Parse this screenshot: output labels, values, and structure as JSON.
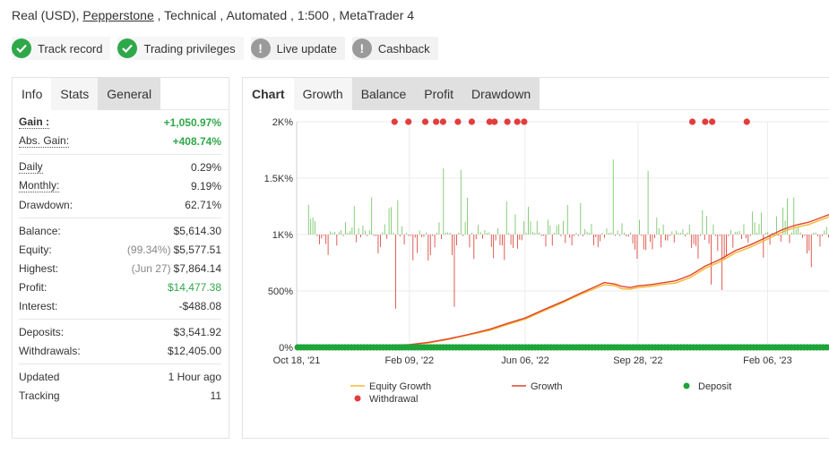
{
  "header": {
    "prefix": "Real (USD), ",
    "broker": "Pepperstone",
    "suffix": " , Technical , Automated , 1:500 , MetaTrader 4"
  },
  "badges": [
    {
      "label": "Track record",
      "status": "verified",
      "icon": "check-circle-icon"
    },
    {
      "label": "Trading privileges",
      "status": "verified",
      "icon": "check-circle-icon"
    },
    {
      "label": "Live update",
      "status": "unverified",
      "icon": "exclamation-circle-icon"
    },
    {
      "label": "Cashback",
      "status": "unverified",
      "icon": "exclamation-circle-icon"
    }
  ],
  "left_tabs": [
    "Info",
    "Stats",
    "General"
  ],
  "stats": {
    "gain": {
      "label": "Gain :",
      "value": "+1,050.97%"
    },
    "abs_gain": {
      "label": "Abs. Gain:",
      "value": "+408.74%"
    },
    "daily": {
      "label": "Daily",
      "value": "0.29%"
    },
    "monthly": {
      "label": "Monthly:",
      "value": "9.19%"
    },
    "drawdown": {
      "label": "Drawdown:",
      "value": "62.71%"
    },
    "balance": {
      "label": "Balance:",
      "value": "$5,614.30"
    },
    "equity": {
      "label": "Equity:",
      "note": "(99.34%)",
      "value": "$5,577.51"
    },
    "highest": {
      "label": "Highest:",
      "note": "(Jun 27)",
      "value": "$7,864.14"
    },
    "profit": {
      "label": "Profit:",
      "value": "$14,477.38"
    },
    "interest": {
      "label": "Interest:",
      "value": "-$488.08"
    },
    "deposits": {
      "label": "Deposits:",
      "value": "$3,541.92"
    },
    "withdrawals": {
      "label": "Withdrawals:",
      "value": "$12,405.00"
    },
    "updated": {
      "label": "Updated",
      "value": "1 Hour ago"
    },
    "tracking": {
      "label": "Tracking",
      "value": "11"
    }
  },
  "right_tabs": [
    "Chart",
    "Growth",
    "Balance",
    "Profit",
    "Drawdown"
  ],
  "colors": {
    "verified": "#2fa84a",
    "unverified": "#9a9a9a",
    "equity": "#f5b731",
    "growth": "#e0452b",
    "deposit": "#1ea53a",
    "withdrawal": "#e23d3d",
    "bar_up": "#6cbf5c",
    "bar_down": "#d9342a"
  },
  "chart_data": {
    "type": "line",
    "ylim": [
      0,
      2000
    ],
    "y_ticks": [
      {
        "value": 0,
        "label": "0%"
      },
      {
        "value": 500,
        "label": "500%"
      },
      {
        "value": 1000,
        "label": "1K%"
      },
      {
        "value": 1500,
        "label": "1.5K%"
      },
      {
        "value": 2000,
        "label": "2K%"
      }
    ],
    "x_range": [
      "2021-10-18",
      "2023-04-10"
    ],
    "x_ticks": [
      {
        "date": "2021-10-18",
        "label": "Oct 18, '21"
      },
      {
        "date": "2022-02-09",
        "label": "Feb 09, '22"
      },
      {
        "date": "2022-06-06",
        "label": "Jun 06, '22"
      },
      {
        "date": "2022-09-28",
        "label": "Sep 28, '22"
      },
      {
        "date": "2023-02-06",
        "label": "Feb 06, '23"
      }
    ],
    "series": [
      {
        "name": "Equity Growth",
        "points": [
          [
            "2021-10-18",
            0
          ],
          [
            "2021-12-01",
            2
          ],
          [
            "2022-01-01",
            8
          ],
          [
            "2022-01-20",
            15
          ],
          [
            "2022-02-09",
            22
          ],
          [
            "2022-03-01",
            40
          ],
          [
            "2022-03-20",
            70
          ],
          [
            "2022-04-10",
            110
          ],
          [
            "2022-05-01",
            150
          ],
          [
            "2022-05-20",
            205
          ],
          [
            "2022-06-06",
            250
          ],
          [
            "2022-06-25",
            325
          ],
          [
            "2022-07-15",
            400
          ],
          [
            "2022-08-01",
            470
          ],
          [
            "2022-08-15",
            520
          ],
          [
            "2022-08-25",
            555
          ],
          [
            "2022-09-05",
            545
          ],
          [
            "2022-09-12",
            520
          ],
          [
            "2022-09-20",
            515
          ],
          [
            "2022-09-28",
            530
          ],
          [
            "2022-10-10",
            540
          ],
          [
            "2022-10-25",
            560
          ],
          [
            "2022-11-05",
            570
          ],
          [
            "2022-11-20",
            620
          ],
          [
            "2022-12-05",
            700
          ],
          [
            "2022-12-20",
            760
          ],
          [
            "2023-01-05",
            840
          ],
          [
            "2023-01-20",
            890
          ],
          [
            "2023-02-06",
            960
          ],
          [
            "2023-02-20",
            1020
          ],
          [
            "2023-03-05",
            1060
          ],
          [
            "2023-03-20",
            1090
          ],
          [
            "2023-04-01",
            1130
          ],
          [
            "2023-04-10",
            1160
          ]
        ]
      },
      {
        "name": "Growth",
        "points": [
          [
            "2021-10-18",
            0
          ],
          [
            "2021-12-01",
            3
          ],
          [
            "2022-01-01",
            10
          ],
          [
            "2022-01-20",
            18
          ],
          [
            "2022-02-09",
            25
          ],
          [
            "2022-03-01",
            45
          ],
          [
            "2022-03-20",
            75
          ],
          [
            "2022-04-10",
            115
          ],
          [
            "2022-05-01",
            160
          ],
          [
            "2022-05-20",
            215
          ],
          [
            "2022-06-06",
            260
          ],
          [
            "2022-06-25",
            335
          ],
          [
            "2022-07-15",
            410
          ],
          [
            "2022-08-01",
            480
          ],
          [
            "2022-08-15",
            535
          ],
          [
            "2022-08-25",
            575
          ],
          [
            "2022-09-05",
            560
          ],
          [
            "2022-09-12",
            540
          ],
          [
            "2022-09-20",
            530
          ],
          [
            "2022-09-28",
            545
          ],
          [
            "2022-10-10",
            555
          ],
          [
            "2022-10-25",
            575
          ],
          [
            "2022-11-05",
            590
          ],
          [
            "2022-11-20",
            640
          ],
          [
            "2022-12-05",
            720
          ],
          [
            "2022-12-20",
            780
          ],
          [
            "2023-01-05",
            860
          ],
          [
            "2023-01-20",
            910
          ],
          [
            "2023-02-06",
            980
          ],
          [
            "2023-02-20",
            1040
          ],
          [
            "2023-03-05",
            1080
          ],
          [
            "2023-03-20",
            1110
          ],
          [
            "2023-04-01",
            1150
          ],
          [
            "2023-04-10",
            1180
          ]
        ]
      }
    ],
    "deposits": {
      "name": "Deposit",
      "note": "near-daily deposit markers along the 0% baseline across the full date range"
    },
    "withdrawals": {
      "name": "Withdrawal",
      "marker_value": 2000,
      "dates": [
        "2022-01-25",
        "2022-02-08",
        "2022-02-25",
        "2022-03-08",
        "2022-03-15",
        "2022-03-30",
        "2022-04-13",
        "2022-05-01",
        "2022-05-06",
        "2022-05-19",
        "2022-05-29",
        "2022-06-05",
        "2022-11-22",
        "2022-12-05",
        "2022-12-12",
        "2023-01-16"
      ]
    },
    "daily_bars": {
      "baseline": 1000,
      "description": "daily gain (green, above 1K%) and loss (red, below 1K%) bars around the 1K% line"
    },
    "legend": [
      {
        "name": "Equity Growth",
        "kind": "line"
      },
      {
        "name": "Growth",
        "kind": "line"
      },
      {
        "name": "Deposit",
        "kind": "dot"
      },
      {
        "name": "Withdrawal",
        "kind": "dot"
      }
    ],
    "grid": true,
    "legend_position": "bottom"
  }
}
